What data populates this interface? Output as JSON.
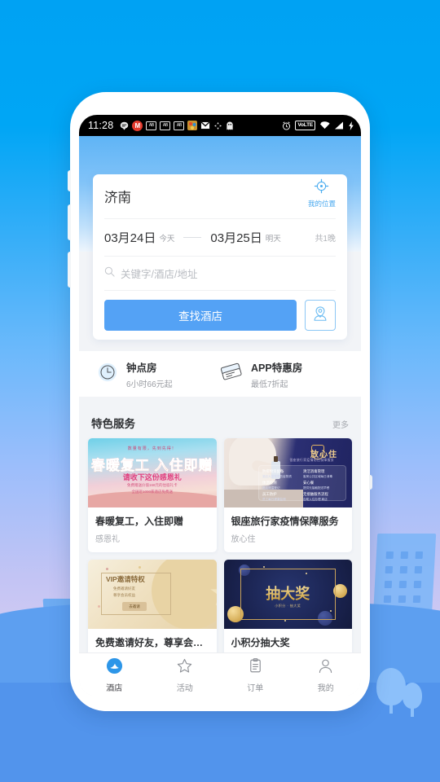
{
  "statusbar": {
    "time": "11:28",
    "left_icons": [
      "chat-bubble-icon",
      "m-badge-icon",
      "ab-box-icon-1",
      "ab-box-icon-2",
      "ab-box-icon-3",
      "colorful-app-icon",
      "gmail-icon",
      "sync-icon",
      "ghost-app-icon"
    ],
    "right_icons": [
      "alarm-icon",
      "volte-icon",
      "wifi-icon",
      "signal-icon",
      "charging-icon"
    ],
    "volte_label": "VoLTE"
  },
  "search_card": {
    "city": "济南",
    "location_button_label": "我的位置",
    "location_icon": "crosshair-icon",
    "checkin_date": "03月24日",
    "checkin_tag": "今天",
    "checkout_date": "03月25日",
    "checkout_tag": "明天",
    "nights": "共1晚",
    "keyword_placeholder": "关键字/酒店/地址",
    "keyword_value": "",
    "search_icon": "search-icon",
    "search_button": "查找酒店",
    "map_button_icon": "map-pin-person-icon"
  },
  "quick_entries": [
    {
      "icon": "clock-icon",
      "title": "钟点房",
      "subtitle": "6小时66元起"
    },
    {
      "icon": "ticket-icon",
      "title": "APP特惠房",
      "subtitle": "最低7折起"
    }
  ],
  "services": {
    "title": "特色服务",
    "more_label": "更多",
    "cards": [
      {
        "name": "春暖复工，入住即赠",
        "sub": "感恩礼",
        "poster": {
          "top_line": "数量有限，先到先得！",
          "headline": "春暖复工 入住即赠",
          "line2": "请收下这份感恩礼",
          "line3": "免费赠送价值168元的住宿礼卡",
          "line4": "全国近1000家酒店免费送"
        }
      },
      {
        "name": "银座旅行家疫情保障服务",
        "sub": "放心住",
        "poster": {
          "brand": "放心住",
          "brand_sub": "银座旅行家疫情防控保障服务",
          "items": [
            {
              "t": "防疫物资配备",
              "d": "酒店大堂常备防疫物资"
            },
            {
              "t": "清洁消毒管理",
              "d": "客房公共区域每日消毒"
            },
            {
              "t": "体温检测",
              "d": "进店测温登记"
            },
            {
              "t": "安心餐",
              "d": "提供无接触配送早餐"
            },
            {
              "t": "员工防护",
              "d": "员工每日健康监测"
            },
            {
              "t": "无接触服务流程",
              "d": "自助入住办理 离店"
            }
          ]
        }
      },
      {
        "name": "免费邀请好友，尊享会员...",
        "sub": "",
        "poster": {
          "headline": "VIP邀请特权",
          "line1": "免费邀请好友",
          "line2": "尊享会员权益",
          "cta": "去邀请"
        }
      },
      {
        "name": "小积分抽大奖",
        "sub": "",
        "poster": {
          "headline": "抽大奖",
          "sub": "小积分 · 抽大奖"
        }
      }
    ]
  },
  "tabbar": {
    "items": [
      {
        "icon": "hotel-icon",
        "label": "酒店",
        "active": true
      },
      {
        "icon": "star-icon",
        "label": "活动",
        "active": false
      },
      {
        "icon": "clipboard-icon",
        "label": "订单",
        "active": false
      },
      {
        "icon": "person-icon",
        "label": "我的",
        "active": false
      }
    ]
  },
  "colors": {
    "accent": "#54a2f5",
    "wallpaper_top": "#00a2f3",
    "wallpaper_bottom": "#dcd2f3",
    "tab_active": "#3f3f44"
  }
}
